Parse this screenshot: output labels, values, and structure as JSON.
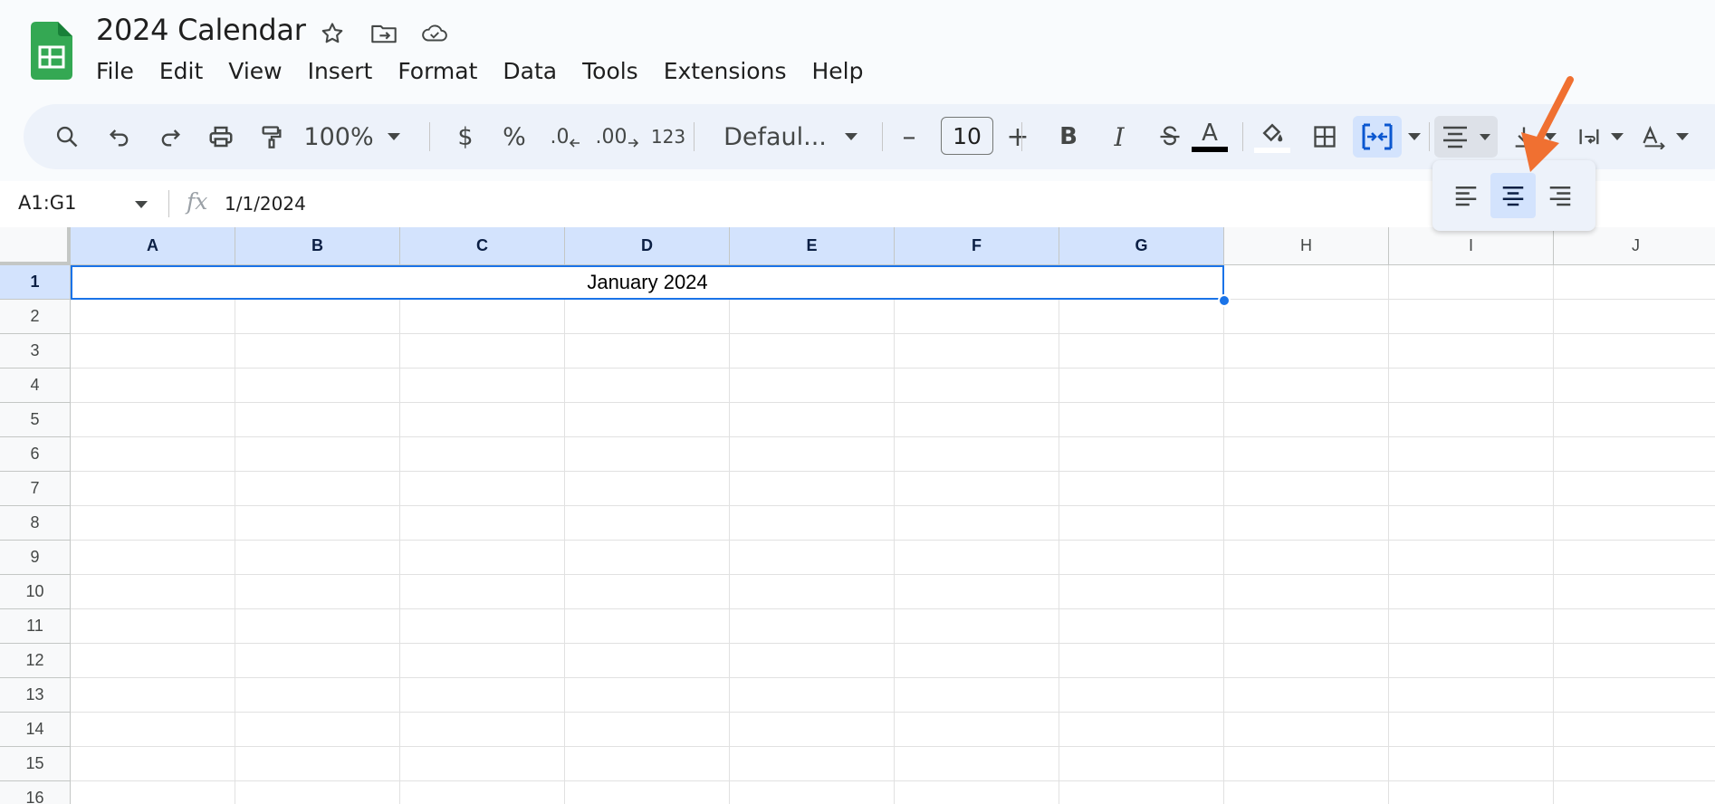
{
  "doc": {
    "title": "2024 Calendar"
  },
  "menu": [
    "File",
    "Edit",
    "View",
    "Insert",
    "Format",
    "Data",
    "Tools",
    "Extensions",
    "Help"
  ],
  "toolbar": {
    "zoom": "100%",
    "currency": "$",
    "percent": "%",
    "decrease_decimal": ".0",
    "increase_decimal": ".00",
    "number_format": "123",
    "font": "Defaul...",
    "font_size": "10",
    "minus": "–",
    "plus": "+",
    "bold": "B",
    "italic": "I",
    "text_color_letter": "A",
    "text_color": "#000000",
    "fill_color": "#ffffff"
  },
  "formula_bar": {
    "name_box": "A1:G1",
    "fx": "fx",
    "value": "1/1/2024"
  },
  "grid": {
    "columns": [
      "A",
      "B",
      "C",
      "D",
      "E",
      "F",
      "G",
      "H",
      "I",
      "J"
    ],
    "selected_columns": [
      "A",
      "B",
      "C",
      "D",
      "E",
      "F",
      "G"
    ],
    "rows": [
      "1",
      "2",
      "3",
      "4",
      "5",
      "6",
      "7",
      "8",
      "9",
      "10",
      "11",
      "12",
      "13",
      "14",
      "15",
      "16"
    ],
    "selected_row": "1",
    "merged_cell_text": "January 2024"
  },
  "align_menu": {
    "options": [
      "align-left",
      "align-center",
      "align-right"
    ],
    "active": "align-center"
  },
  "colors": {
    "accent": "#1a73e8",
    "selection": "#d3e3fd",
    "annotation_arrow": "#f07031",
    "logo_green": "#34a853"
  }
}
